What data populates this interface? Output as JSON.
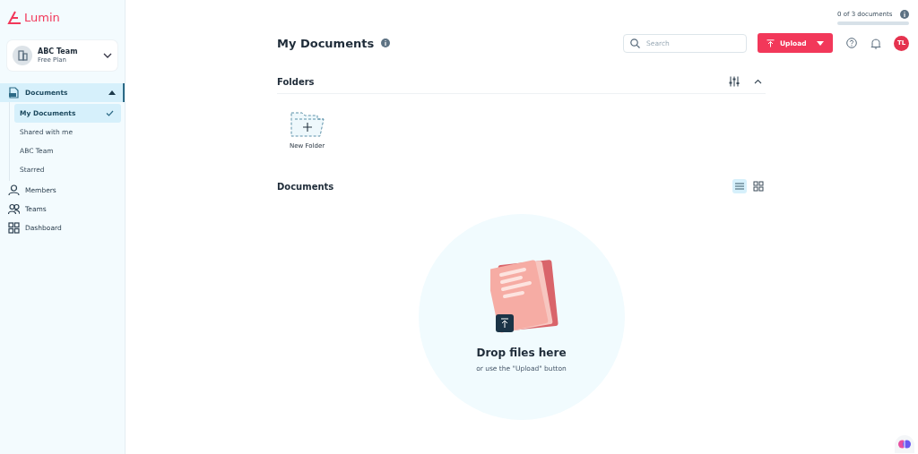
{
  "brand": {
    "name": "Lumin"
  },
  "team_switcher": {
    "name": "ABC Team",
    "plan": "Free Plan"
  },
  "nav": [
    {
      "label": "Documents",
      "kind": "document",
      "expanded": true,
      "selected": true,
      "children": [
        {
          "label": "My Documents",
          "selected": true
        },
        {
          "label": "Shared with me",
          "selected": false
        },
        {
          "label": "ABC Team",
          "selected": false
        },
        {
          "label": "Starred",
          "selected": false
        }
      ]
    },
    {
      "label": "Members",
      "kind": "person",
      "selected": false
    },
    {
      "label": "Teams",
      "kind": "people",
      "selected": false
    },
    {
      "label": "Dashboard",
      "kind": "grid",
      "selected": false
    }
  ],
  "quota": {
    "text": "0 of 3 documents",
    "level": 0
  },
  "header": {
    "title": "My Documents",
    "search": {
      "placeholder": "Search"
    },
    "upload_button": "Upload",
    "avatar": "TL"
  },
  "folders": {
    "title": "Folders",
    "expanded": true,
    "items": [
      {
        "label": "New Folder"
      }
    ]
  },
  "documents": {
    "title": "Documents",
    "views": [
      {
        "kind": "list",
        "selected": true
      },
      {
        "kind": "grid",
        "selected": false
      }
    ],
    "empty_state": {
      "title": "Drop files here",
      "subtitle": "or use the \"Upload\" button"
    }
  }
}
